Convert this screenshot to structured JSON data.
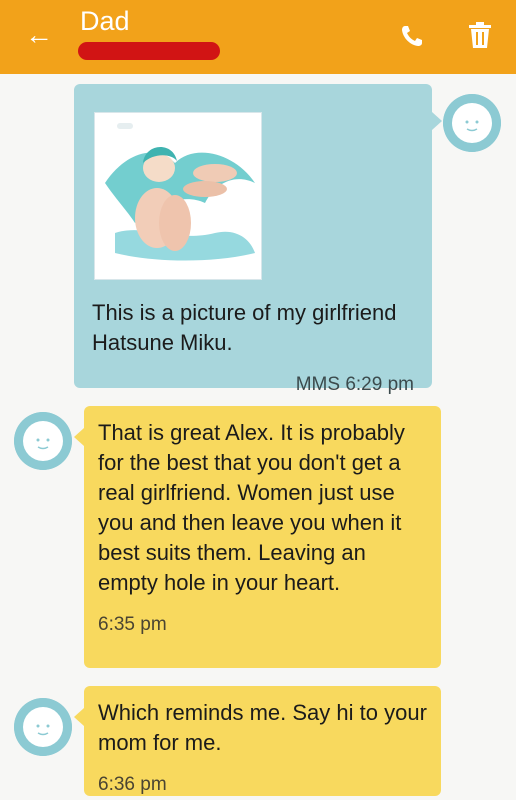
{
  "header": {
    "contact_name": "Dad",
    "back_icon": "arrow-left-icon",
    "call_icon": "phone-icon",
    "delete_icon": "trash-icon",
    "bar_color": "#f2a21a"
  },
  "messages": [
    {
      "direction": "outgoing",
      "has_image": true,
      "text": "This is a picture of my girlfriend Hatsune Miku.",
      "meta": "MMS 6:29 pm",
      "bubble_color": "#a8d6dc"
    },
    {
      "direction": "incoming",
      "has_image": false,
      "text": "That is great Alex. It is probably for the best that you don't get a real girlfriend. Women just use you and then leave you when it best suits them. Leaving an empty hole in your heart.",
      "meta": "6:35 pm",
      "bubble_color": "#f8d95e"
    },
    {
      "direction": "incoming",
      "has_image": false,
      "text": "Which reminds me. Say hi to your mom for me.",
      "meta": "6:36 pm",
      "bubble_color": "#f8d95e"
    }
  ]
}
